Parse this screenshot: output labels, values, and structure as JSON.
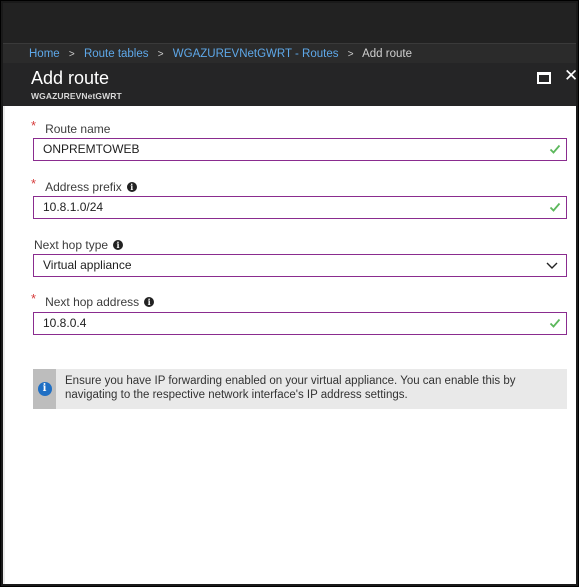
{
  "breadcrumb": {
    "items": [
      "Home",
      "Route tables",
      "WGAZUREVNetGWRT - Routes"
    ],
    "current": "Add route",
    "separator": ">"
  },
  "blade": {
    "title": "Add route",
    "subtitle": "WGAZUREVNetGWRT"
  },
  "form": {
    "route_name": {
      "label": "Route name",
      "value": "ONPREMTOWEB",
      "required": true
    },
    "address_prefix": {
      "label": "Address prefix",
      "value": "10.8.1.0/24",
      "required": true
    },
    "next_hop_type": {
      "label": "Next hop type",
      "value": "Virtual appliance",
      "required": false
    },
    "next_hop_address": {
      "label": "Next hop address",
      "value": "10.8.0.4",
      "required": true
    }
  },
  "notice": {
    "line1": "Ensure you have IP forwarding enabled on your virtual appliance. You can enable this by",
    "line2": "navigating to the respective network interface's IP address settings."
  },
  "icons": {
    "required": "*",
    "info": "i",
    "close": "✕"
  },
  "colors": {
    "accent_border": "#8a2c8f",
    "check_green": "#5cb85c",
    "link_blue": "#5ea8e9",
    "required_red": "#d63a3a",
    "info_blue": "#1f6fc4"
  }
}
